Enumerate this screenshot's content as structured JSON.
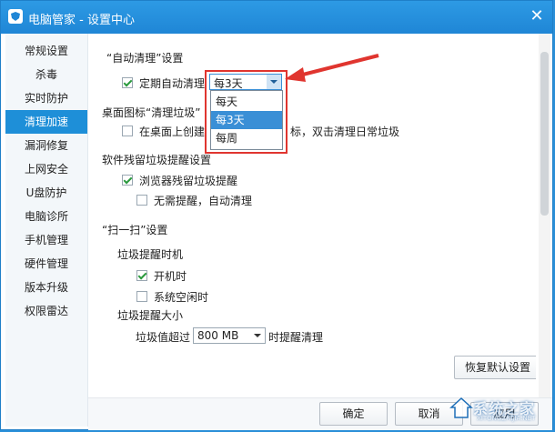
{
  "window": {
    "title": "电脑管家 - 设置中心"
  },
  "sidebar": {
    "items": [
      {
        "label": "常规设置"
      },
      {
        "label": "杀毒"
      },
      {
        "label": "实时防护"
      },
      {
        "label": "清理加速",
        "active": true
      },
      {
        "label": "漏洞修复"
      },
      {
        "label": "上网安全"
      },
      {
        "label": "U盘防护"
      },
      {
        "label": "电脑诊所"
      },
      {
        "label": "手机管理"
      },
      {
        "label": "硬件管理"
      },
      {
        "label": "版本升级"
      },
      {
        "label": "权限雷达"
      }
    ]
  },
  "auto_clean": {
    "heading": "“自动清理”设置",
    "checkbox_label": "定期自动清理",
    "checked": true,
    "select_value": "每3天",
    "options": [
      "每天",
      "每3天",
      "每周"
    ],
    "selected_option": "每3天"
  },
  "desktop_icon": {
    "heading": "桌面图标“清理垃圾”",
    "checkbox_label_start": "在桌面上创建",
    "checkbox_label_end": "标，双击清理日常垃圾",
    "checked": false
  },
  "residue": {
    "heading": "软件残留垃圾提醒设置",
    "browser_label": "浏览器残留垃圾提醒",
    "browser_checked": true,
    "auto_label": "无需提醒，自动清理",
    "auto_checked": false
  },
  "scan": {
    "heading": "“扫一扫”设置",
    "timing_heading": "垃圾提醒时机",
    "boot_label": "开机时",
    "boot_checked": true,
    "idle_label": "系统空闲时",
    "idle_checked": false,
    "size_heading": "垃圾提醒大小",
    "size_prefix": "垃圾值超过",
    "size_value": "800 MB",
    "size_suffix": "时提醒清理"
  },
  "buttons": {
    "restore": "恢复默认设置",
    "ok": "确定",
    "cancel": "取消",
    "apply": "应用"
  },
  "watermark": {
    "text": "系统之家",
    "sub": "XITONGZHIJIA.NET"
  },
  "colors": {
    "accent": "#1e8fd8",
    "highlight": "#e0352f"
  }
}
